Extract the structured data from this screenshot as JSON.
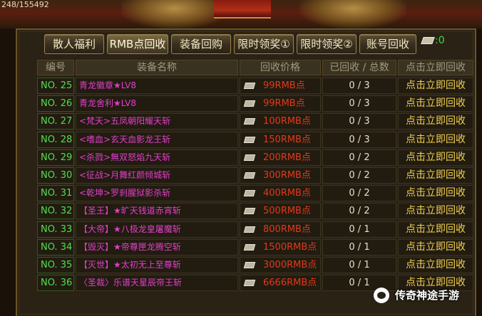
{
  "top": {
    "coords": "248/155492"
  },
  "tabs": [
    {
      "label": "散人福利",
      "active": false
    },
    {
      "label": "RMB点回收",
      "active": true
    },
    {
      "label": "装备回购",
      "active": false
    },
    {
      "label": "限时领奖①",
      "active": false
    },
    {
      "label": "限时领奖②",
      "active": false
    },
    {
      "label": "账号回收",
      "active": false
    }
  ],
  "currency": {
    "icon": "ticket-icon",
    "value": ":0"
  },
  "table": {
    "headers": [
      "编号",
      "装备名称",
      "回收价格",
      "已回收 / 总数",
      "点击立即回收"
    ],
    "rows": [
      {
        "num": "NO. 25",
        "name": "青龙徽章★LV8",
        "price": "99RMB点",
        "count": "0 / 3",
        "action": "点击立即回收"
      },
      {
        "num": "NO. 26",
        "name": "青龙舍利★LV8",
        "price": "99RMB点",
        "count": "0 / 3",
        "action": "点击立即回收"
      },
      {
        "num": "NO. 27",
        "name": "<梵天>五凤朝阳耀天斩",
        "price": "100RMB点",
        "count": "0 / 3",
        "action": "点击立即回收"
      },
      {
        "num": "NO. 28",
        "name": "<嗜血>玄天血影龙王斩",
        "price": "150RMB点",
        "count": "0 / 3",
        "action": "点击立即回收"
      },
      {
        "num": "NO. 29",
        "name": "<杀戮>無双怒焰九天斩",
        "price": "200RMB点",
        "count": "0 / 2",
        "action": "点击立即回收"
      },
      {
        "num": "NO. 30",
        "name": "<征战>月舞红颜倾城斩",
        "price": "300RMB点",
        "count": "0 / 2",
        "action": "点击立即回收"
      },
      {
        "num": "NO. 31",
        "name": "<乾坤>罗刹腥狱影杀斩",
        "price": "400RMB点",
        "count": "0 / 2",
        "action": "点击立即回收"
      },
      {
        "num": "NO. 32",
        "name": "【圣王】★旷天钱道赤宵斩",
        "price": "500RMB点",
        "count": "0 / 2",
        "action": "点击立即回收"
      },
      {
        "num": "NO. 33",
        "name": "【大帝】★八极龙皇屠魔斩",
        "price": "800RMB点",
        "count": "0 / 1",
        "action": "点击立即回收"
      },
      {
        "num": "NO. 34",
        "name": "【毁灭】★帝尊匣龙腾空斩",
        "price": "1500RMB点",
        "count": "0 / 1",
        "action": "点击立即回收"
      },
      {
        "num": "NO. 35",
        "name": "【灭世】★太初无上至尊斩",
        "price": "3000RMB点",
        "count": "0 / 1",
        "action": "点击立即回收"
      },
      {
        "num": "NO. 36",
        "name": "〈圣裁〉乐谱天星辰帝王斩",
        "price": "6666RMB点",
        "count": "0 / 1",
        "action": "点击立即回收"
      }
    ]
  },
  "watermark": {
    "text": "传奇神途手游"
  },
  "colors": {
    "num": "#4ee04e",
    "name": "#e040c8",
    "price": "#e23a1a",
    "action": "#f0d050"
  }
}
